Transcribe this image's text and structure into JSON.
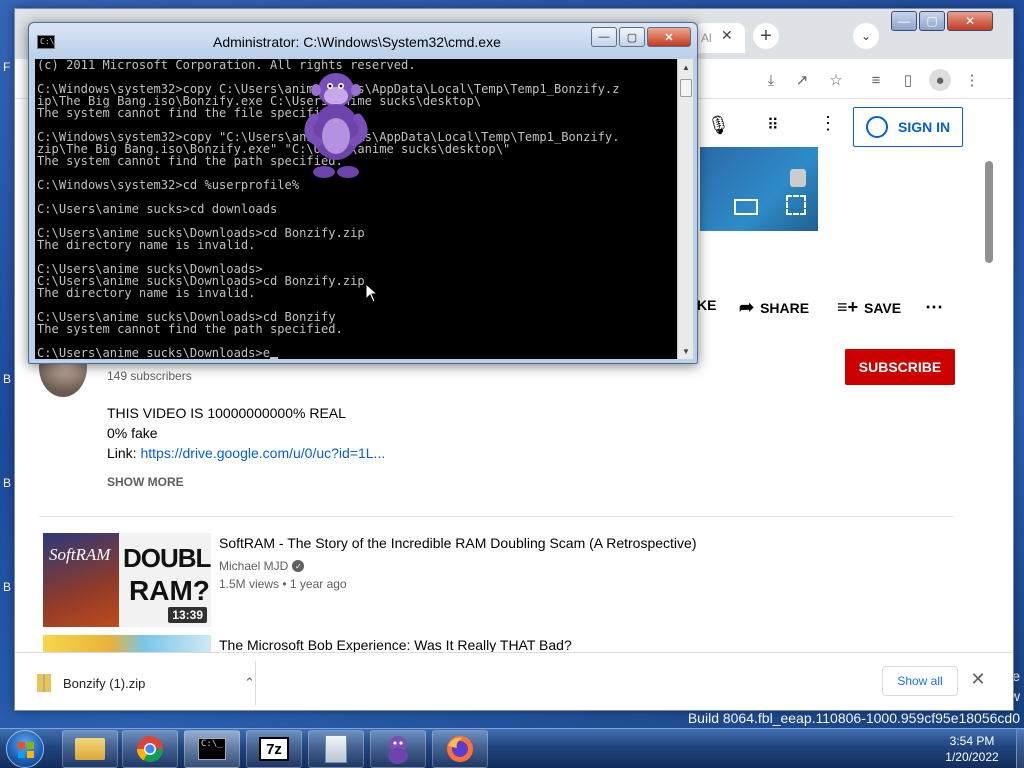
{
  "desktop": {
    "watermark_line1": "ode",
    "watermark_line2": "view",
    "build_text": "Build 8064.fbl_eeap.110806-1000.959cf95e18056cd0",
    "side_letters": [
      "F",
      "B",
      "B",
      "B"
    ]
  },
  "cmd": {
    "title": "Administrator: C:\\Windows\\System32\\cmd.exe",
    "icon_text": "C:\\_",
    "lines": [
      "(c) 2011 Microsoft Corporation. All rights reserved.",
      "",
      "C:\\Windows\\system32>copy C:\\Users\\anime sucks\\AppData\\Local\\Temp\\Temp1_Bonzify.z",
      "ip\\The Big Bang.iso\\Bonzify.exe C:\\Users\\anime sucks\\desktop\\",
      "The system cannot find the file specified.",
      "",
      "C:\\Windows\\system32>copy \"C:\\Users\\anime sucks\\AppData\\Local\\Temp\\Temp1_Bonzify.",
      "zip\\The Big Bang.iso\\Bonzify.exe\" \"C:\\Users\\anime sucks\\desktop\\\"",
      "The system cannot find the path specified.",
      "",
      "C:\\Windows\\system32>cd %userprofile%",
      "",
      "C:\\Users\\anime sucks>cd downloads",
      "",
      "C:\\Users\\anime sucks\\Downloads>cd Bonzify.zip",
      "The directory name is invalid.",
      "",
      "C:\\Users\\anime sucks\\Downloads>",
      "C:\\Users\\anime sucks\\Downloads>cd Bonzify.zip",
      "The directory name is invalid.",
      "",
      "C:\\Users\\anime sucks\\Downloads>cd Bonzify",
      "The system cannot find the path specified.",
      ""
    ],
    "prompt_line": "C:\\Users\\anime sucks\\Downloads>e"
  },
  "chrome": {
    "tab_fragment": "Al",
    "window_buttons": [
      "—",
      "▢",
      "✕"
    ]
  },
  "youtube": {
    "sign_in_label": "SIGN IN",
    "actions": {
      "like_fragment": "KE",
      "share": "SHARE",
      "save": "SAVE"
    },
    "subscribers": "149 subscribers",
    "subscribe_label": "SUBSCRIBE",
    "description": {
      "line1": "THIS VIDEO IS 10000000000% REAL",
      "line2": "0% fake",
      "link_prefix": "Link: ",
      "link": "https://drive.google.com/u/0/uc?id=1L..."
    },
    "show_more": "SHOW MORE",
    "recommendations": [
      {
        "title": "SoftRAM - The Story of the Incredible RAM Doubling Scam (A Retrospective)",
        "channel": "Michael MJD",
        "meta": "1.5M views • 1 year ago",
        "duration": "13:39",
        "thumb_text_left": "SoftRAM",
        "thumb_text_right_1": "DOUBLE",
        "thumb_text_right_2": "RAM?!"
      },
      {
        "title": "The Microsoft Bob Experience: Was It Really THAT Bad?",
        "channel": "",
        "meta": "",
        "duration": ""
      }
    ]
  },
  "downloads": {
    "file_name": "Bonzify (1).zip",
    "show_all": "Show all"
  },
  "taskbar": {
    "time": "3:54 PM",
    "date": "1/20/2022",
    "apps": [
      "explorer",
      "chrome",
      "cmd",
      "7-zip",
      "bonzi-installer",
      "bonzi-buddy",
      "firefox"
    ],
    "seven_zip_label": "7z"
  },
  "colors": {
    "subscribe": "#cc0000",
    "youtube_link": "#065fd4",
    "desktop_blue": "#2b5fb0",
    "bonzi_purple": "#7b4fb8"
  }
}
